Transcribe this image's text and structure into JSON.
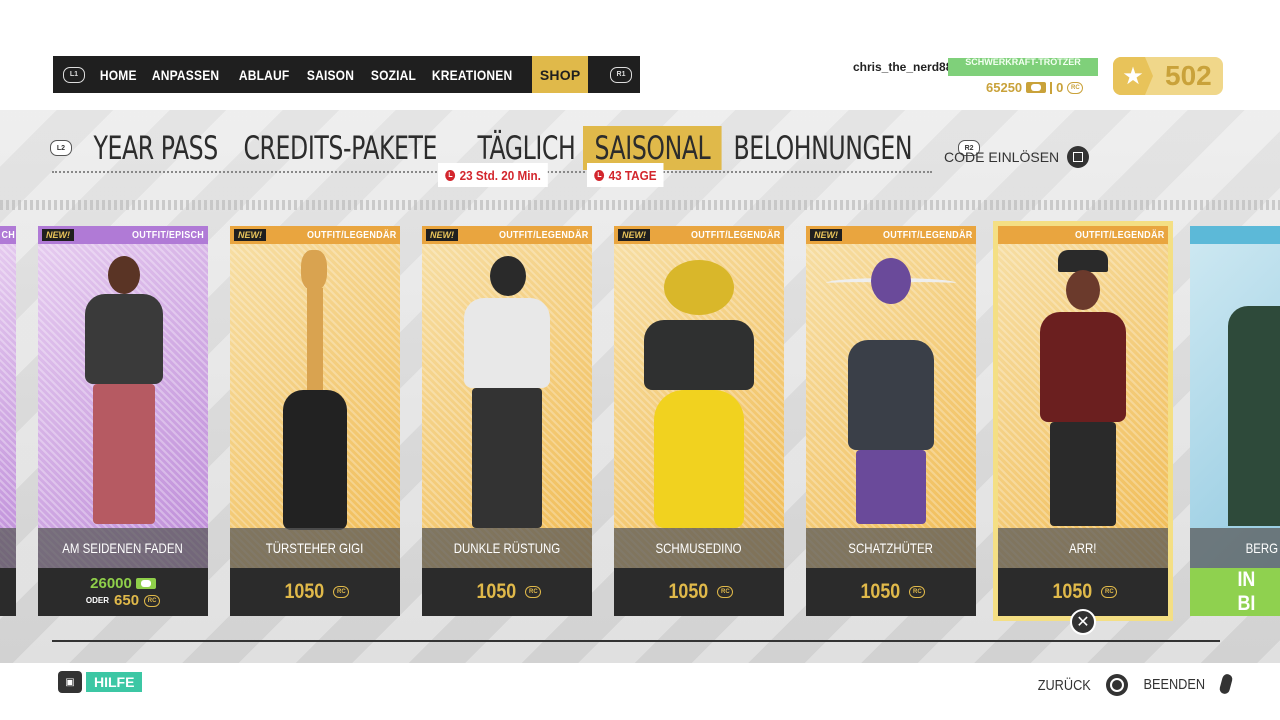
{
  "topnav": {
    "left_hint": "L1",
    "right_hint": "R1",
    "items": [
      "HOME",
      "ANPASSEN",
      "ABLAUF",
      "SAISON",
      "SOZIAL",
      "KREATIONEN",
      "SHOP"
    ],
    "active": "SHOP"
  },
  "player": {
    "username": "chris_the_nerd88",
    "rank": "SCHWERKRAFT-TROTZER",
    "credits": "65250",
    "rc": "0",
    "stars": "502"
  },
  "subtabs": {
    "left_hint": "L2",
    "right_hint": "R2",
    "items": [
      "YEAR PASS",
      "CREDITS-PAKETE",
      "TÄGLICH",
      "SAISONAL",
      "BELOHNUNGEN"
    ],
    "active": "SAISONAL",
    "timer_daily": "23 Std. 20 Min.",
    "timer_season": "43 TAGE",
    "code_redeem": "CODE EINLÖSEN"
  },
  "cards": [
    {
      "new": "NEW!",
      "rarity": "OUTFIT/EPISCH",
      "name": "AM SEIDENEN FADEN",
      "price_credits": "26000",
      "or": "ODER",
      "price": "650"
    },
    {
      "new": "NEW!",
      "rarity": "OUTFIT/LEGENDÄR",
      "name": "TÜRSTEHER GIGI",
      "price": "1050"
    },
    {
      "new": "NEW!",
      "rarity": "OUTFIT/LEGENDÄR",
      "name": "DUNKLE RÜSTUNG",
      "price": "1050"
    },
    {
      "new": "NEW!",
      "rarity": "OUTFIT/LEGENDÄR",
      "name": "SCHMUSEDINO",
      "price": "1050"
    },
    {
      "new": "NEW!",
      "rarity": "OUTFIT/LEGENDÄR",
      "name": "SCHATZHÜTER",
      "price": "1050"
    },
    {
      "rarity": "OUTFIT/LEGENDÄR",
      "name": "ARR!",
      "price": "1050"
    }
  ],
  "partial_left": {
    "rarity": "CH"
  },
  "partial_right": {
    "name": "BERG",
    "button": "IN BI"
  },
  "rc_label": "RC",
  "footer": {
    "help": "HILFE",
    "back": "ZURÜCK",
    "quit": "BEENDEN"
  },
  "colors": {
    "accent": "#e0b94a",
    "legendary": "#e9a53f",
    "epic": "#b07ad6",
    "timer": "#d3262d",
    "help": "#3cc7a4",
    "rank": "#7fd07a"
  }
}
